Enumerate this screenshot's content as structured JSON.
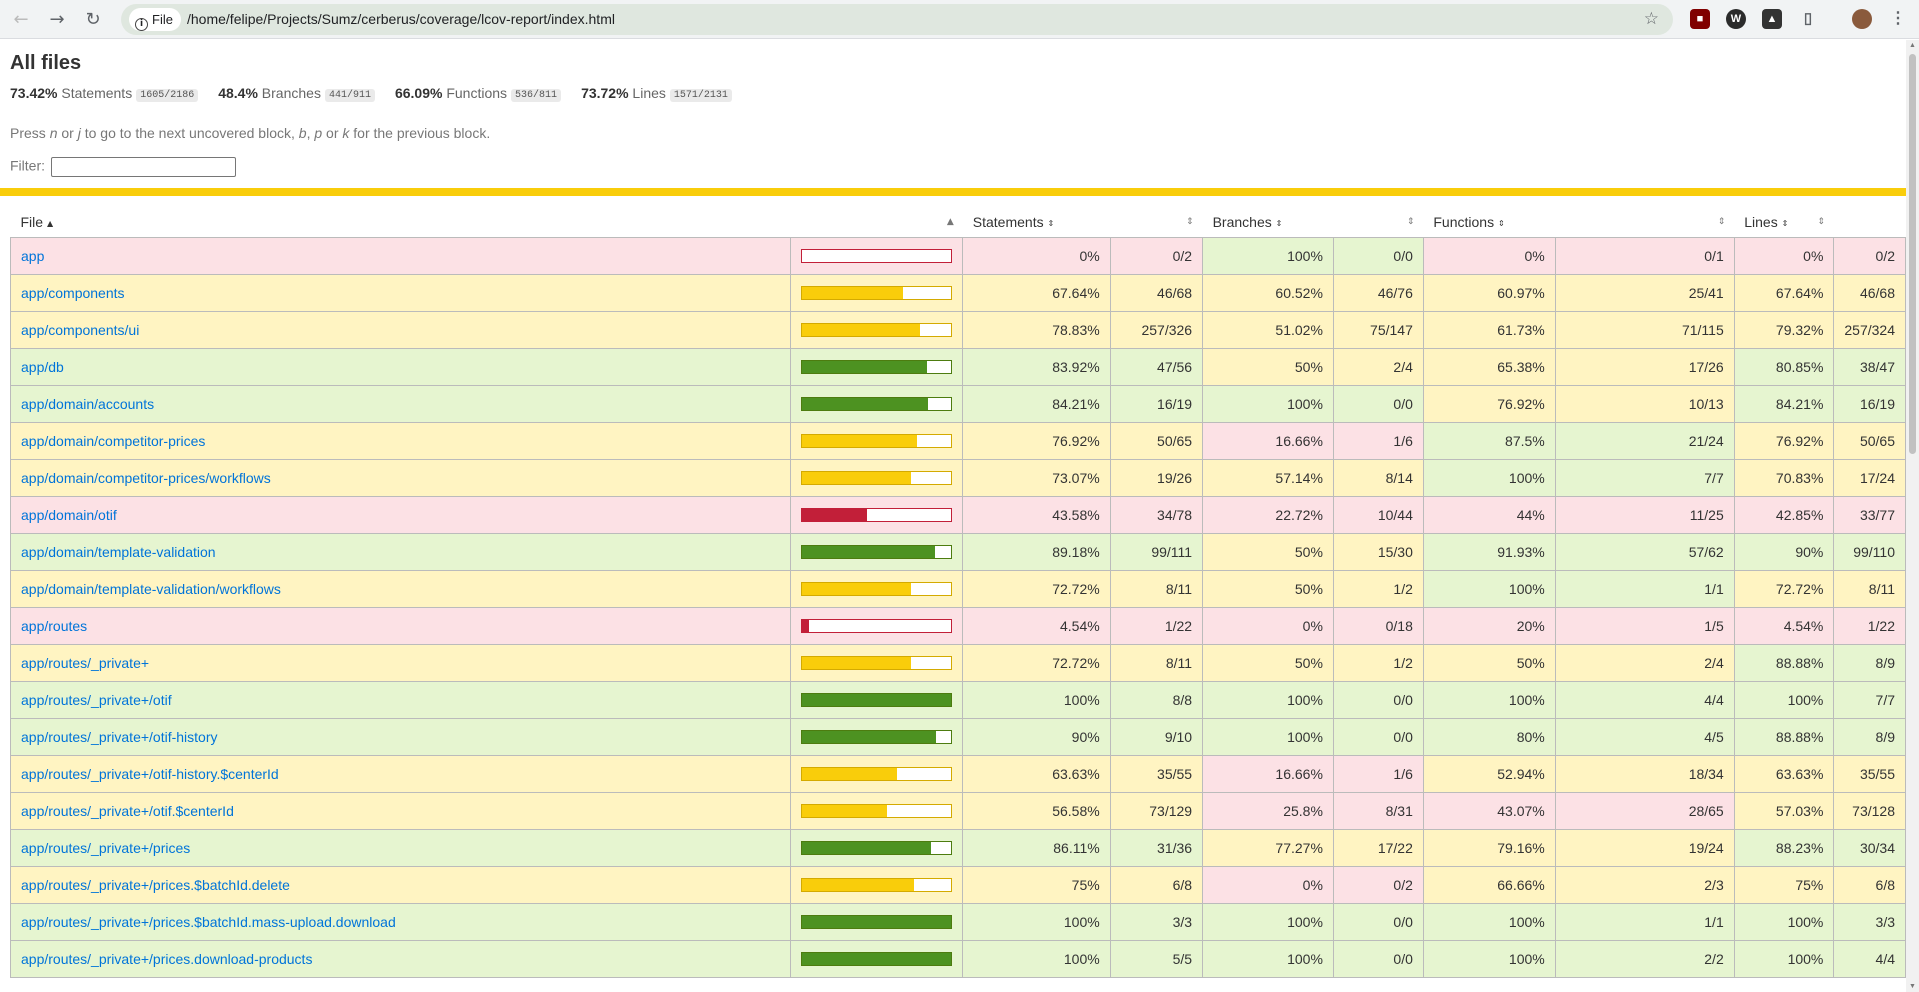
{
  "browser": {
    "file_chip_label": "File",
    "url": "/home/felipe/Projects/Sumz/cerberus/coverage/lcov-report/index.html"
  },
  "page": {
    "title": "All files",
    "summary": [
      {
        "pct": "73.42%",
        "label": "Statements",
        "fraction": "1605/2186"
      },
      {
        "pct": "48.4%",
        "label": "Branches",
        "fraction": "441/911"
      },
      {
        "pct": "66.09%",
        "label": "Functions",
        "fraction": "536/811"
      },
      {
        "pct": "73.72%",
        "label": "Lines",
        "fraction": "1571/2131"
      }
    ],
    "hint_parts": [
      "Press ",
      "n",
      " or ",
      "j",
      " to go to the next uncovered block, ",
      "b",
      ", ",
      "p",
      " or ",
      "k",
      " for the previous block."
    ],
    "filter_label": "Filter:"
  },
  "table": {
    "headers": [
      "File",
      "Statements",
      "Branches",
      "Functions",
      "Lines"
    ],
    "rows": [
      {
        "file": "app",
        "s": "0%",
        "sf": "0/2",
        "b": "100%",
        "bf": "0/0",
        "f": "0%",
        "ff": "0/1",
        "l": "0%",
        "lf": "0/2"
      },
      {
        "file": "app/components",
        "s": "67.64%",
        "sf": "46/68",
        "b": "60.52%",
        "bf": "46/76",
        "f": "60.97%",
        "ff": "25/41",
        "l": "67.64%",
        "lf": "46/68"
      },
      {
        "file": "app/components/ui",
        "s": "78.83%",
        "sf": "257/326",
        "b": "51.02%",
        "bf": "75/147",
        "f": "61.73%",
        "ff": "71/115",
        "l": "79.32%",
        "lf": "257/324"
      },
      {
        "file": "app/db",
        "s": "83.92%",
        "sf": "47/56",
        "b": "50%",
        "bf": "2/4",
        "f": "65.38%",
        "ff": "17/26",
        "l": "80.85%",
        "lf": "38/47"
      },
      {
        "file": "app/domain/accounts",
        "s": "84.21%",
        "sf": "16/19",
        "b": "100%",
        "bf": "0/0",
        "f": "76.92%",
        "ff": "10/13",
        "l": "84.21%",
        "lf": "16/19"
      },
      {
        "file": "app/domain/competitor-prices",
        "s": "76.92%",
        "sf": "50/65",
        "b": "16.66%",
        "bf": "1/6",
        "f": "87.5%",
        "ff": "21/24",
        "l": "76.92%",
        "lf": "50/65"
      },
      {
        "file": "app/domain/competitor-prices/workflows",
        "s": "73.07%",
        "sf": "19/26",
        "b": "57.14%",
        "bf": "8/14",
        "f": "100%",
        "ff": "7/7",
        "l": "70.83%",
        "lf": "17/24"
      },
      {
        "file": "app/domain/otif",
        "s": "43.58%",
        "sf": "34/78",
        "b": "22.72%",
        "bf": "10/44",
        "f": "44%",
        "ff": "11/25",
        "l": "42.85%",
        "lf": "33/77"
      },
      {
        "file": "app/domain/template-validation",
        "s": "89.18%",
        "sf": "99/111",
        "b": "50%",
        "bf": "15/30",
        "f": "91.93%",
        "ff": "57/62",
        "l": "90%",
        "lf": "99/110"
      },
      {
        "file": "app/domain/template-validation/workflows",
        "s": "72.72%",
        "sf": "8/11",
        "b": "50%",
        "bf": "1/2",
        "f": "100%",
        "ff": "1/1",
        "l": "72.72%",
        "lf": "8/11"
      },
      {
        "file": "app/routes",
        "s": "4.54%",
        "sf": "1/22",
        "b": "0%",
        "bf": "0/18",
        "f": "20%",
        "ff": "1/5",
        "l": "4.54%",
        "lf": "1/22"
      },
      {
        "file": "app/routes/_private+",
        "s": "72.72%",
        "sf": "8/11",
        "b": "50%",
        "bf": "1/2",
        "f": "50%",
        "ff": "2/4",
        "l": "88.88%",
        "lf": "8/9"
      },
      {
        "file": "app/routes/_private+/otif",
        "s": "100%",
        "sf": "8/8",
        "b": "100%",
        "bf": "0/0",
        "f": "100%",
        "ff": "4/4",
        "l": "100%",
        "lf": "7/7"
      },
      {
        "file": "app/routes/_private+/otif-history",
        "s": "90%",
        "sf": "9/10",
        "b": "100%",
        "bf": "0/0",
        "f": "80%",
        "ff": "4/5",
        "l": "88.88%",
        "lf": "8/9"
      },
      {
        "file": "app/routes/_private+/otif-history.$centerId",
        "s": "63.63%",
        "sf": "35/55",
        "b": "16.66%",
        "bf": "1/6",
        "f": "52.94%",
        "ff": "18/34",
        "l": "63.63%",
        "lf": "35/55"
      },
      {
        "file": "app/routes/_private+/otif.$centerId",
        "s": "56.58%",
        "sf": "73/129",
        "b": "25.8%",
        "bf": "8/31",
        "f": "43.07%",
        "ff": "28/65",
        "l": "57.03%",
        "lf": "73/128"
      },
      {
        "file": "app/routes/_private+/prices",
        "s": "86.11%",
        "sf": "31/36",
        "b": "77.27%",
        "bf": "17/22",
        "f": "79.16%",
        "ff": "19/24",
        "l": "88.23%",
        "lf": "30/34"
      },
      {
        "file": "app/routes/_private+/prices.$batchId.delete",
        "s": "75%",
        "sf": "6/8",
        "b": "0%",
        "bf": "0/2",
        "f": "66.66%",
        "ff": "2/3",
        "l": "75%",
        "lf": "6/8"
      },
      {
        "file": "app/routes/_private+/prices.$batchId.mass-upload.download",
        "s": "100%",
        "sf": "3/3",
        "b": "100%",
        "bf": "0/0",
        "f": "100%",
        "ff": "1/1",
        "l": "100%",
        "lf": "3/3"
      },
      {
        "file": "app/routes/_private+/prices.download-products",
        "s": "100%",
        "sf": "5/5",
        "b": "100%",
        "bf": "0/0",
        "f": "100%",
        "ff": "2/2",
        "l": "100%",
        "lf": "4/4"
      }
    ]
  },
  "colors": {
    "high": "#e6f5d0",
    "medium": "#fff4c2",
    "low": "#fce1e5",
    "bar_high": "#4d9221",
    "bar_medium": "#f9cd0b",
    "bar_low": "#c21f39"
  }
}
